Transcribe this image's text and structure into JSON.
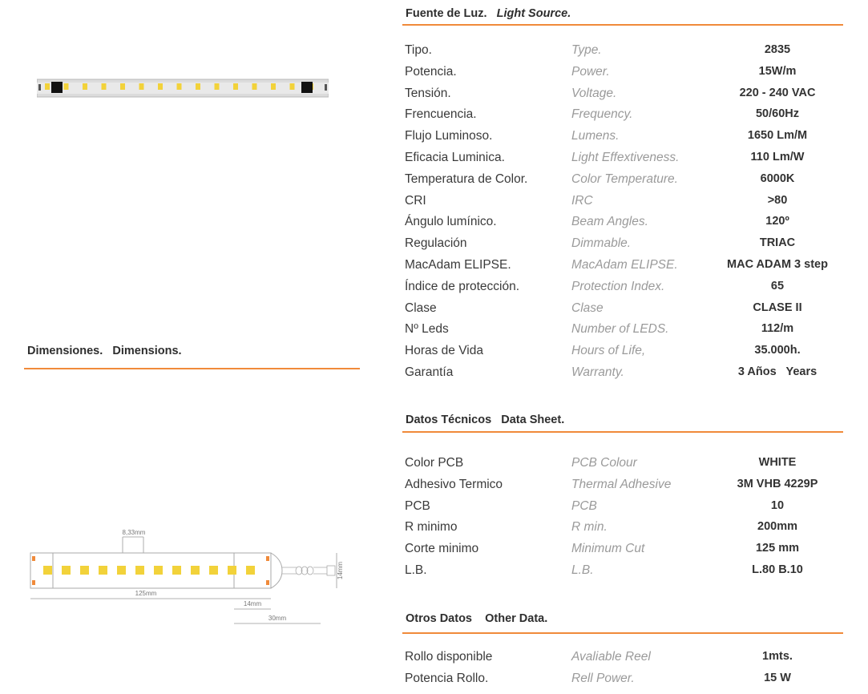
{
  "colors": {
    "accent": "#f08a3a",
    "led": "#f2d23a"
  },
  "light_source": {
    "heading_es": "Fuente de Luz.",
    "heading_en": "Light Source.",
    "rows": [
      {
        "es": "Tipo.",
        "en": "Type.",
        "value": "2835"
      },
      {
        "es": "Potencia.",
        "en": "Power.",
        "value": "15W/m"
      },
      {
        "es": "Tensión.",
        "en": "Voltage.",
        "value": "220 - 240 VAC"
      },
      {
        "es": "Frencuencia.",
        "en": "Frequency.",
        "value": "50/60Hz"
      },
      {
        "es": "Flujo Luminoso.",
        "en": "Lumens.",
        "value": "1650 Lm/M"
      },
      {
        "es": "Eficacia Luminica.",
        "en": "Light Effextiveness.",
        "value": "110 Lm/W"
      },
      {
        "es": "Temperatura de Color.",
        "en": "Color Temperature.",
        "value": "6000K"
      },
      {
        "es": "CRI",
        "en": "IRC",
        "value": ">80"
      },
      {
        "es": "Ángulo lumínico.",
        "en": "Beam Angles.",
        "value": "120º"
      },
      {
        "es": "Regulación",
        "en": "Dimmable.",
        "value": "TRIAC"
      },
      {
        "es": "MacAdam ELIPSE.",
        "en": "MacAdam ELIPSE.",
        "value": "MAC ADAM 3 step"
      },
      {
        "es": "Índice de protección.",
        "en": "Protection Index.",
        "value": "65"
      },
      {
        "es": "Clase",
        "en": "Clase",
        "value": "CLASE II"
      },
      {
        "es": "Nº Leds",
        "en": "Number of LEDS.",
        "value": "112/m"
      },
      {
        "es": "Horas de Vida",
        "en": "Hours of Life,",
        "value": "35.000h."
      },
      {
        "es": "Garantía",
        "en": "Warranty.",
        "value": "3 Años   Years"
      }
    ]
  },
  "data_sheet": {
    "heading": "Datos Técnicos   Data Sheet.",
    "rows": [
      {
        "es": "Color PCB",
        "en": "PCB Colour",
        "value": "WHITE"
      },
      {
        "es": "Adhesivo Termico",
        "en": "Thermal Adhesive",
        "value": "3M VHB 4229P"
      },
      {
        "es": "PCB",
        "en": "PCB",
        "value": "10"
      },
      {
        "es": "R minimo",
        "en": "R min.",
        "value": "200mm"
      },
      {
        "es": "Corte minimo",
        "en": "Minimum Cut",
        "value": "125 mm"
      },
      {
        "es": "L.B.",
        "en": "L.B.",
        "value": "L.80 B.10"
      }
    ]
  },
  "other_data": {
    "heading": "Otros Datos    Other Data.",
    "rows": [
      {
        "es": "Rollo disponible",
        "en": "Avaliable Reel",
        "value": "1mts."
      },
      {
        "es": "Potencia Rollo.",
        "en": "Rell Power.",
        "value": "15 W"
      }
    ]
  },
  "dimensions": {
    "heading": "Dimensiones.   Dimensions.",
    "labels": {
      "pitch": "8,33mm",
      "length": "125mm",
      "end_cap": "14mm",
      "connector": "30mm",
      "height": "14mm"
    }
  }
}
